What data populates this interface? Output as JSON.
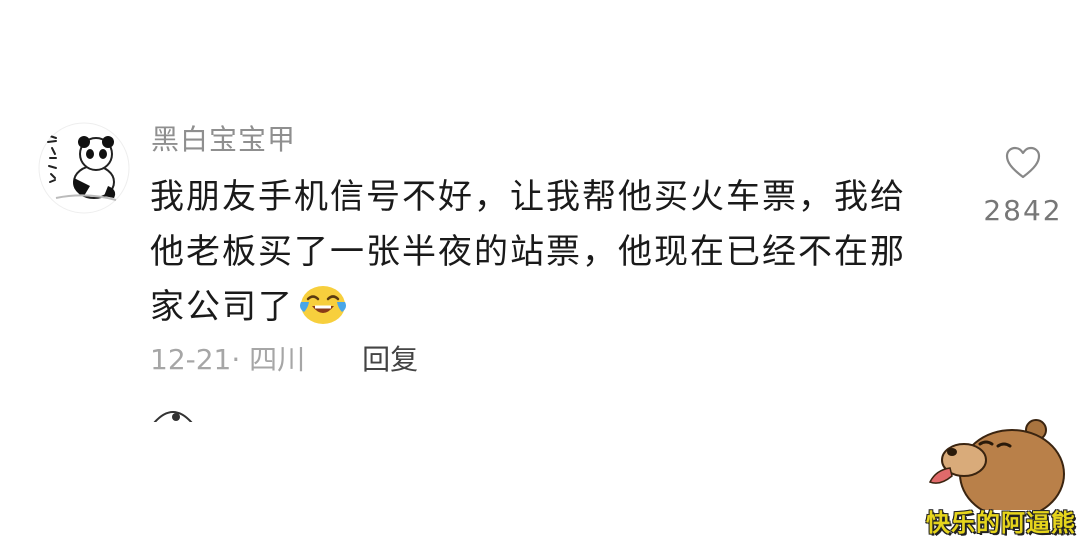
{
  "comment": {
    "username": "黑白宝宝甲",
    "lines": [
      "我朋友手机信号不好，让我帮他买火车票，我给",
      "他老板买了一张半夜的站票，他现在已经不在那",
      "家公司了"
    ],
    "emoji": "laughing-crying-emoji",
    "date_location": "12-21· 四川",
    "reply_label": "回复",
    "like_count": "2842"
  },
  "watermark": {
    "text": "快乐的阿逼熊"
  },
  "colors": {
    "text": "#1a1a1a",
    "username": "#8f8f8f",
    "meta": "#a6a6a6",
    "watermark_text": "#e6d51c"
  }
}
